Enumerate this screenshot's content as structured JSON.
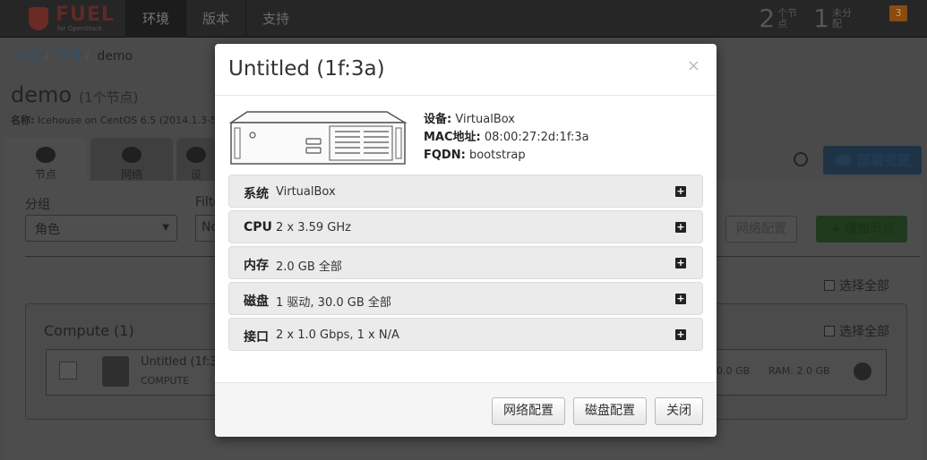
{
  "navbar": {
    "logo_text": "FUEL",
    "logo_sub": "for OpenStack",
    "tabs": [
      {
        "label": "环境",
        "active": true
      },
      {
        "label": "版本",
        "active": false
      },
      {
        "label": "支持",
        "active": false
      }
    ],
    "stats": [
      {
        "number": "2",
        "label": "个节点"
      },
      {
        "number": "1",
        "label": "未分配"
      }
    ],
    "notification_count": "3"
  },
  "breadcrumb": {
    "home": "首页",
    "envs": "环境",
    "current": "demo"
  },
  "env": {
    "title": "demo",
    "node_count": "(1个节点)",
    "name_label": "名称:",
    "name_value": "Icehouse on CentOS 6.5 (2014.1.3-5.1"
  },
  "background": {
    "tabs": [
      {
        "label": "节点"
      },
      {
        "label": "网络"
      },
      {
        "label": "设"
      }
    ],
    "group_label": "分组",
    "filter_label": "Filte",
    "group_select_value": "角色",
    "filter_input_value": "Nc",
    "deploy_button": "部署变更",
    "net_config_button": "网络配置",
    "add_node_button": "增加节点",
    "select_all": "选择全部",
    "group_title": "Compute (1)",
    "node": {
      "name": "Untitled (1f:3a",
      "role": "COMPUTE",
      "hdd": "0.0 GB",
      "ram": "RAM: 2.0 GB"
    }
  },
  "modal": {
    "title": "Untitled (1f:3a)",
    "close_symbol": "×",
    "info": {
      "manufacturer_label": "设备:",
      "manufacturer_value": "VirtualBox",
      "mac_label": "MAC地址:",
      "mac_value": "08:00:27:2d:1f:3a",
      "fqdn_label": "FQDN:",
      "fqdn_value": "bootstrap"
    },
    "sections": [
      {
        "name": "系统",
        "value": "VirtualBox"
      },
      {
        "name": "CPU",
        "value": "2 x 3.59 GHz"
      },
      {
        "name": "内存",
        "value": "2.0 GB 全部"
      },
      {
        "name": "磁盘",
        "value": "1 驱动, 30.0 GB 全部"
      },
      {
        "name": "接口",
        "value": "2 x 1.0 Gbps, 1 x N/A"
      }
    ],
    "expand_symbol": "+",
    "buttons": {
      "network_config": "网络配置",
      "disk_config": "磁盘配置",
      "close": "关闭"
    }
  }
}
